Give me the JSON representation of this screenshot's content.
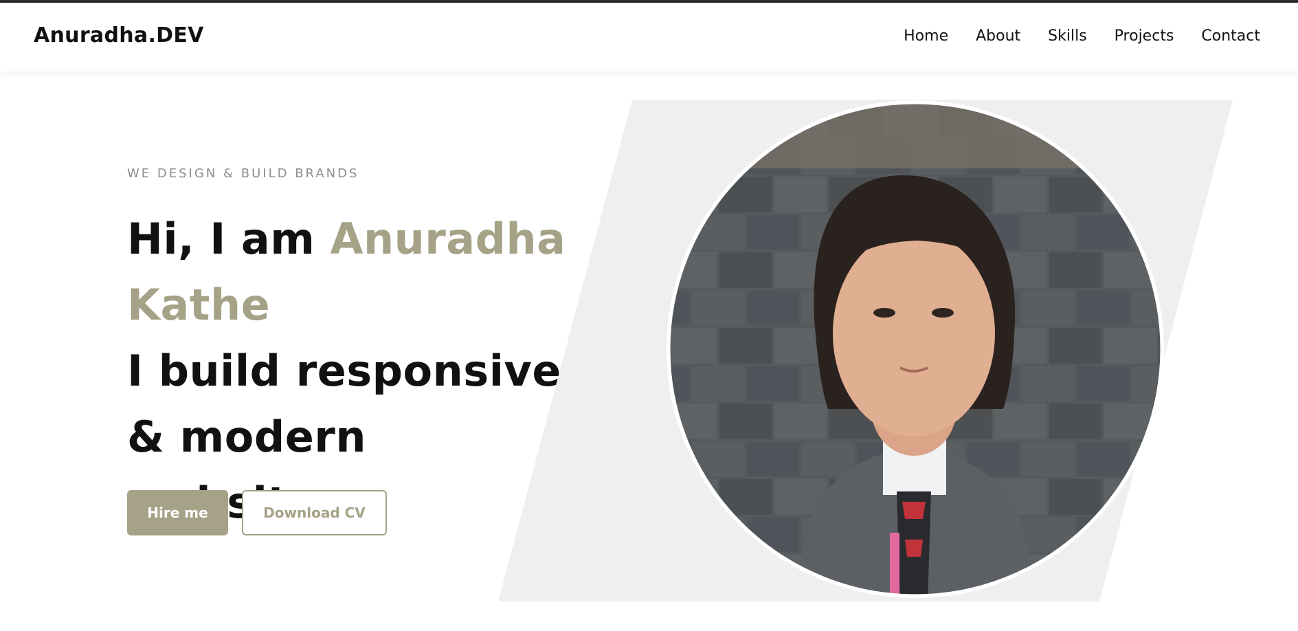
{
  "brand": {
    "logo": "Anuradha.DEV"
  },
  "nav": {
    "items": [
      {
        "label": "Home"
      },
      {
        "label": "About"
      },
      {
        "label": "Skills"
      },
      {
        "label": "Projects"
      },
      {
        "label": "Contact"
      }
    ]
  },
  "hero": {
    "tagline": "WE DESIGN & BUILD BRANDS",
    "greeting": "Hi, I am ",
    "name": "Anuradha Kathe",
    "subline": "I build responsive & modern websites.",
    "hire_label": "Hire me",
    "cv_label": "Download CV"
  },
  "colors": {
    "accent": "#a6a287",
    "panel": "#efefef",
    "text": "#111111"
  },
  "icons": {
    "profile": "profile-photo"
  }
}
